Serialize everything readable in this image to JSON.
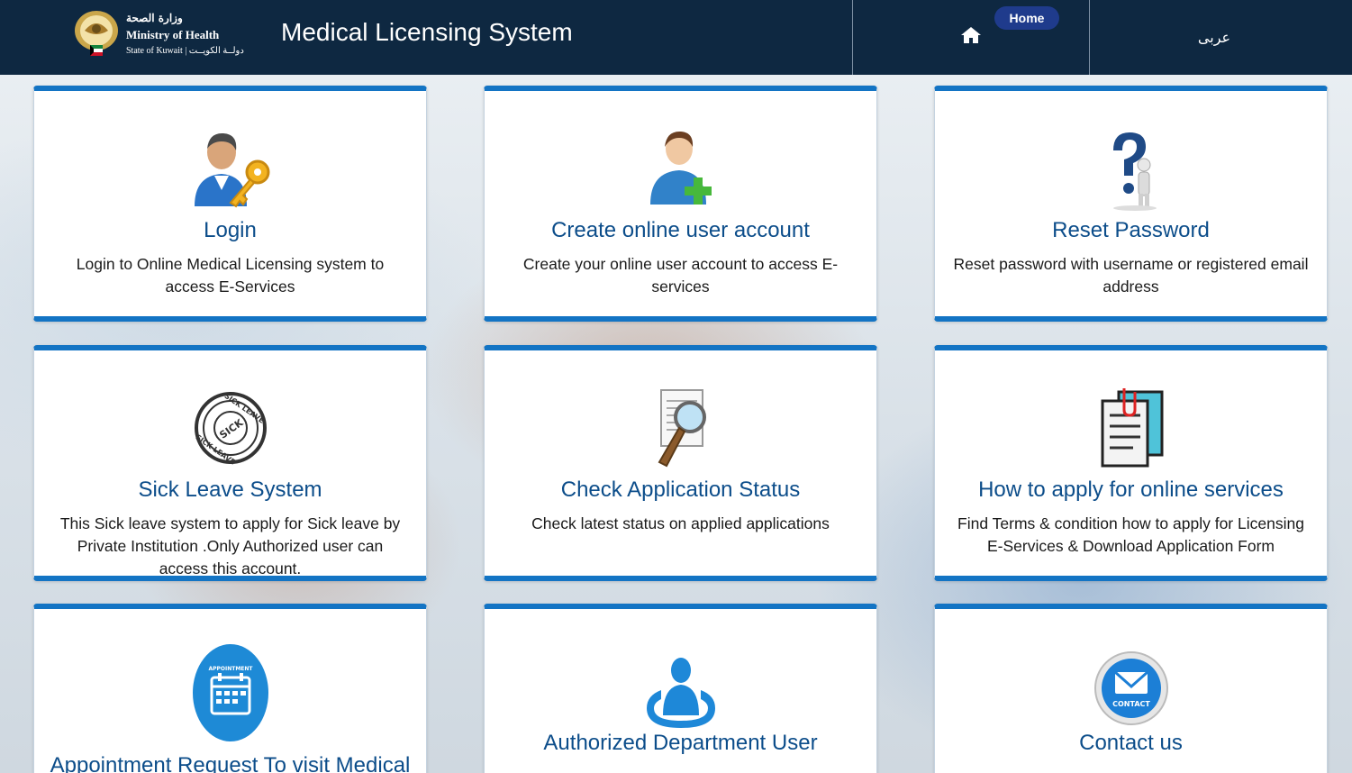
{
  "header": {
    "logo": {
      "arabic_name": "وزارة الصحة",
      "english_name": "Ministry of Health",
      "subtitle": "State of Kuwait  |  دولــة الكويــت"
    },
    "app_title": "Medical Licensing System",
    "nav": {
      "home_icon": "home-icon",
      "home_label": "Home",
      "language_label": "عربى"
    },
    "colors": {
      "header_bg": "#0e2841",
      "badge_bg": "#1f3b8c"
    }
  },
  "cards": [
    {
      "title": "Login",
      "desc": "Login to Online Medical Licensing system to access E-Services",
      "icon": "user-key-icon"
    },
    {
      "title": "Create online user account",
      "desc": "Create your online user account to access E-services",
      "icon": "add-user-icon"
    },
    {
      "title": "Reset Password",
      "desc": "Reset password with username or registered email address",
      "icon": "question-mark-figure-icon"
    },
    {
      "title": "Sick Leave System",
      "desc": "This Sick leave system to apply for Sick leave by Private Institution .Only Authorized user can access this account.",
      "icon": "sick-leave-stamp-icon"
    },
    {
      "title": "Check Application Status",
      "desc": "Check latest status on applied applications",
      "icon": "magnifier-document-icon"
    },
    {
      "title": "How to apply for online services",
      "desc": "Find Terms & condition how to apply for Licensing E-Services & Download Application Form",
      "icon": "clipboard-documents-icon"
    },
    {
      "title": "Appointment Request To visit Medical",
      "desc": "",
      "icon": "appointment-calendar-icon"
    },
    {
      "title": "Authorized Department User",
      "desc": "",
      "icon": "department-user-icon"
    },
    {
      "title": "Contact us",
      "desc": "",
      "icon": "contact-envelope-icon"
    }
  ],
  "colors": {
    "card_accent": "#1374c4",
    "card_title": "#0c4d8a"
  }
}
